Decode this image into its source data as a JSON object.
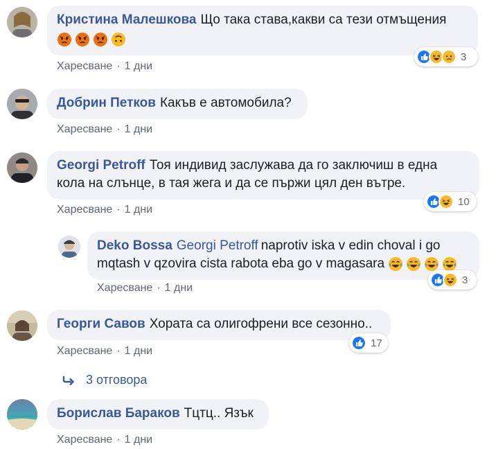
{
  "comments": [
    {
      "author": "Кристина Малешкова",
      "text": "Що така става,какви са тези отмъщения",
      "like_label": "Харесване",
      "time": "1 дни",
      "reaction_count": "3"
    },
    {
      "author": "Добрин Петков",
      "text": "Какъв е автомобила?",
      "like_label": "Харесване",
      "time": "1 дни"
    },
    {
      "author": "Georgi Petroff",
      "text_line1": "Тоя индивид заслужава да го заключиш в една",
      "text_line2": "кола на слънце, в тая жега и да се пържи цял ден вътре.",
      "like_label": "Харесване",
      "time": "1 дни",
      "reaction_count": "10"
    },
    {
      "author": "Deko Bossa",
      "mention": "Georgi Petroff",
      "text_line1": "naprotiv iska v edin choval i go",
      "text_line2": "mqtash v qzovira cista rabota eba go v magasara",
      "like_label": "Харесване",
      "time": "1 дни",
      "reaction_count": "3"
    },
    {
      "author": "Георги Савов",
      "text": "Хората са олигофрени все сезонно..",
      "like_label": "Харесване",
      "time": "1 дни",
      "reaction_count": "17"
    },
    {
      "author": "Борислав Бараков",
      "text": "Тцтц.. Язък",
      "like_label": "Харесване",
      "time": "1 дни"
    }
  ],
  "replies_link": "3 отговора",
  "separator": "·",
  "colors": {
    "link": "#385898",
    "bubble": "#f0f2f5",
    "like_blue": "#1877f2",
    "haha_yellow": "#f7b928",
    "angry_orange": "#e9710f"
  }
}
